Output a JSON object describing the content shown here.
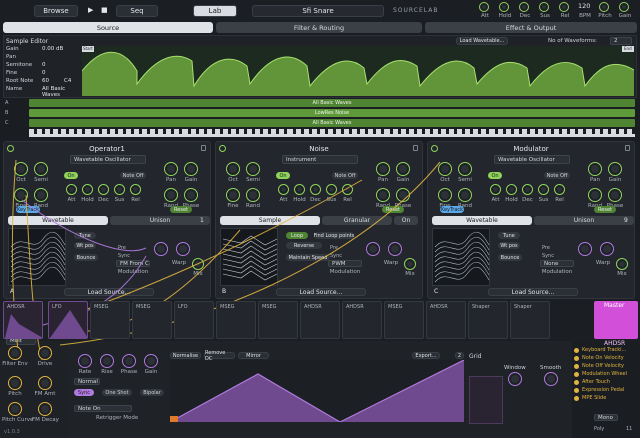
{
  "topbar": {
    "browse": "Browse",
    "play": "▶",
    "stop": "■",
    "seq": "Seq",
    "lab": "Lab",
    "preset": "Sfi Snare",
    "brand": "SOURCELAB",
    "macros": [
      "Att",
      "Hold",
      "Dec",
      "Sus",
      "Rel",
      "BPM",
      "Pitch",
      "Gain"
    ],
    "bpm": "120"
  },
  "main_tabs": [
    "Source",
    "Filter & Routing",
    "Effect & Output"
  ],
  "sample_editor": {
    "title": "Sample Editor",
    "rows": [
      {
        "label": "Gain",
        "value": "0.00 dB"
      },
      {
        "label": "Pan",
        "value": ""
      },
      {
        "label": "Semitone",
        "value": "0"
      },
      {
        "label": "Fine",
        "value": "0"
      },
      {
        "label": "Root Note",
        "value": "60",
        "note": "C4"
      },
      {
        "label": "Name",
        "value": "All Basic Waves"
      }
    ],
    "load_wavetable": "Load Wavetable...",
    "waveforms_label": "No of Waveforms:",
    "waveforms_value": "2",
    "start_tag": "Start",
    "end_tag": "End"
  },
  "tracks": [
    {
      "id": "A",
      "name": "All Basic Waves"
    },
    {
      "id": "B",
      "name": "LowRes Noise"
    },
    {
      "id": "C",
      "name": "All Basic Waves"
    }
  ],
  "operators": [
    {
      "title": "Operator1",
      "type": "Wavetable Oscillator",
      "knobs_a": [
        "Oct",
        "Semi",
        "Fine",
        "Rand"
      ],
      "knobs_b": [
        "Pan",
        "Gain",
        "Rand",
        "Phase"
      ],
      "env": [
        "Att",
        "Hold",
        "Dec",
        "Sus",
        "Rel"
      ],
      "on": "On",
      "noteoff": "Note Off",
      "keytrack": "KeyTrack",
      "reset": "Reset",
      "tabs": [
        "Wavetable",
        "Unison"
      ],
      "unison": "1",
      "wt_tune": "Tune",
      "wt_pos": "Wt pos",
      "bounce": "Bounce",
      "mod_title": "Modulation",
      "mod_sel": "FM From C",
      "warp": "Warp",
      "mix": "Mix",
      "sub_a": "Pre",
      "sub_b": "Sync",
      "load": "Load Source...",
      "letter": "A"
    },
    {
      "title": "Noise",
      "type": "Instrument",
      "knobs_a": [
        "Oct",
        "Semi",
        "Fine",
        "Rand"
      ],
      "knobs_b": [
        "Pan",
        "Gain",
        "Rand",
        "Phase"
      ],
      "env": [
        "Att",
        "Hold",
        "Dec",
        "Sus",
        "Rel"
      ],
      "on": "On",
      "noteoff": "Note Off",
      "keytrack": "",
      "reset": "Reset",
      "tabs": [
        "Sample",
        "Granular",
        "On"
      ],
      "unison": "",
      "wt_tune": "Loop",
      "wt_pos": "Reverse",
      "bounce": "Maintain Speed",
      "mod_title": "Modulation",
      "mod_sel": "PWM",
      "warp": "Warp",
      "mix": "Mix",
      "sub_a": "Pre",
      "sub_b": "Sync",
      "load": "Load Source...",
      "letter": "B",
      "find_loop": "Find Loop points"
    },
    {
      "title": "Modulator",
      "type": "Wavetable Oscillator",
      "knobs_a": [
        "Oct",
        "Semi",
        "Fine",
        "Rand"
      ],
      "knobs_b": [
        "Pan",
        "Gain",
        "Rand",
        "Phase"
      ],
      "env": [
        "Att",
        "Hold",
        "Dec",
        "Sus",
        "Rel"
      ],
      "on": "On",
      "noteoff": "Note Off",
      "keytrack": "KeyTrack",
      "reset": "Reset",
      "tabs": [
        "Wavetable",
        "Unison"
      ],
      "unison": "9",
      "wt_tune": "Tune",
      "wt_pos": "Wt pos",
      "bounce": "Bounce",
      "mod_title": "Modulation",
      "mod_sel": "None",
      "warp": "Warp",
      "mix": "Mix",
      "sub_a": "Pre",
      "sub_b": "Sync",
      "load": "Load Source...",
      "letter": "C"
    }
  ],
  "mod_slots": [
    "AHDSR",
    "LFO",
    "MSEG",
    "MSEG",
    "LFO",
    "MSEG",
    "MSEG",
    "AHDSR",
    "AHDSR",
    "MSEG",
    "AHDSR",
    "Shaper",
    "Shaper"
  ],
  "master": {
    "title": "Master",
    "sub": "AHDSR"
  },
  "bottom_left": {
    "knobs": [
      "Filter Env",
      "Drive",
      "Pitch",
      "FM Amt",
      "Pitch Curve",
      "FM Decay"
    ],
    "mode": "Mult",
    "version": "v1.0.3"
  },
  "lfo_panel": {
    "knobs": [
      "Rate",
      "Rise",
      "Phase",
      "Gain"
    ],
    "mode": "Normal",
    "sync": "Sync",
    "oneshot": "One Shot",
    "bipolar": "Bipolar",
    "note_on": "Note On",
    "retrigger": "Retrigger Mode",
    "buttons": [
      "Normalise",
      "Remove DC",
      "Mirror"
    ],
    "export": "Export...",
    "grid": "Grid",
    "grid_val": "2",
    "window": "Window",
    "smooth": "Smooth"
  },
  "mod_sources": [
    "Keyboard Tracki...",
    "Note On Velocity",
    "Note Off Velocity",
    "Modulation Wheel",
    "After Touch",
    "Expression Pedal",
    "MPE Slide"
  ],
  "footer": {
    "mono": "Mono",
    "poly": "Poly",
    "voices": "11"
  },
  "colors": {
    "green": "#8fd45a",
    "purple": "#b07adf",
    "yellow": "#e0b440",
    "magenta": "#d24fd9"
  }
}
